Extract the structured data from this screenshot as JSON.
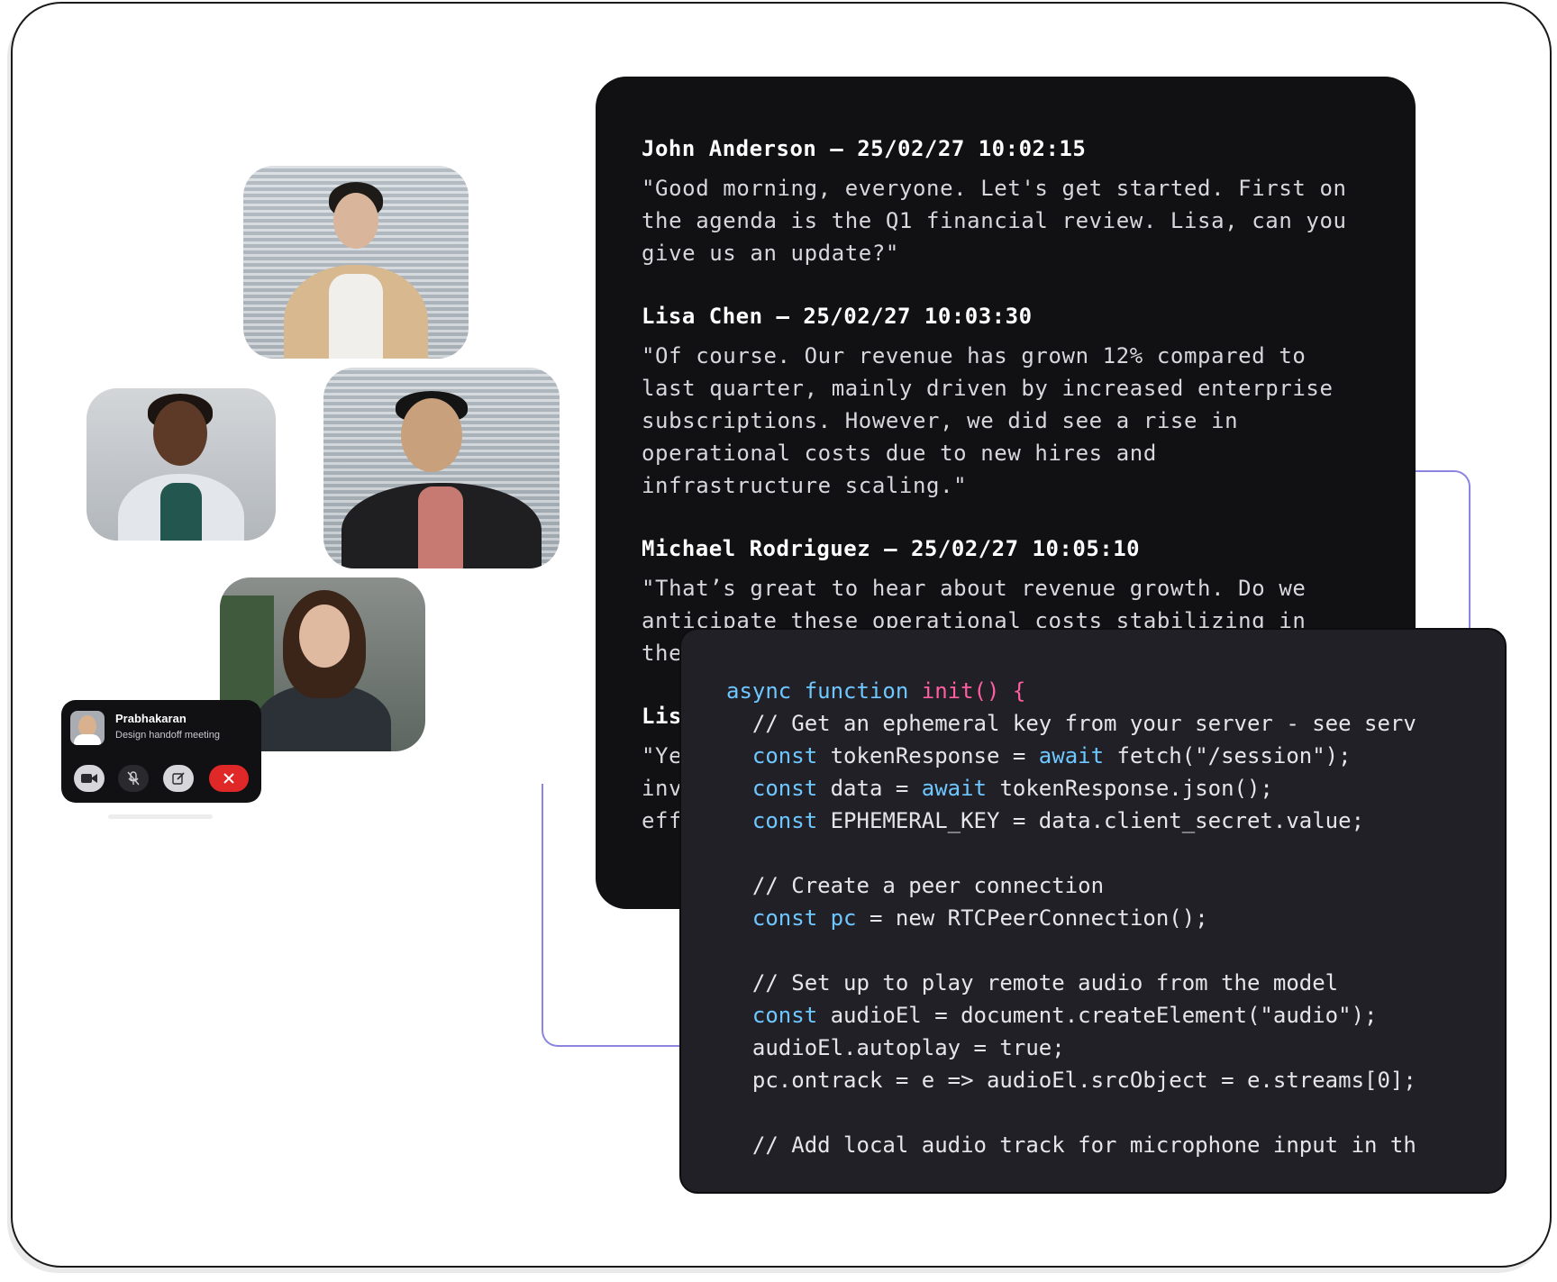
{
  "transcript": {
    "entries": [
      {
        "speaker": "John Anderson – 25/02/27 10:02:15",
        "quote": "\"Good morning, everyone. Let's get started. First on\nthe agenda is the Q1 financial review. Lisa, can you\ngive us an update?\""
      },
      {
        "speaker": "Lisa Chen – 25/02/27 10:03:30",
        "quote": "\"Of course. Our revenue has grown 12% compared to\nlast quarter, mainly driven by increased enterprise\nsubscriptions. However, we did see a rise in\noperational costs due to new hires and\ninfrastructure scaling.\""
      },
      {
        "speaker": "Michael Rodriguez – 25/02/27 10:05:10",
        "quote": "\"That’s great to hear about revenue growth. Do we\nanticipate these operational costs stabilizing in\nthe"
      },
      {
        "speaker": "Lis",
        "quote": "\"Ye\ninv\neff"
      }
    ]
  },
  "code": {
    "lines": [
      [
        {
          "t": "async function ",
          "c": "kw"
        },
        {
          "t": "init() {",
          "c": "fn"
        }
      ],
      [
        {
          "t": "  // Get an ephemeral key from your server - see serv"
        }
      ],
      [
        {
          "t": "  "
        },
        {
          "t": "const",
          "c": "kw"
        },
        {
          "t": " tokenResponse = "
        },
        {
          "t": "await",
          "c": "kw"
        },
        {
          "t": " fetch(\"/session\");"
        }
      ],
      [
        {
          "t": "  "
        },
        {
          "t": "const",
          "c": "kw"
        },
        {
          "t": " data = "
        },
        {
          "t": "await",
          "c": "kw"
        },
        {
          "t": " tokenResponse.json();"
        }
      ],
      [
        {
          "t": "  "
        },
        {
          "t": "const",
          "c": "kw"
        },
        {
          "t": " EPHEMERAL_KEY = data.client_secret.value;"
        }
      ],
      [
        {
          "t": ""
        }
      ],
      [
        {
          "t": "  // Create a peer connection"
        }
      ],
      [
        {
          "t": "  "
        },
        {
          "t": "const",
          "c": "kw"
        },
        {
          "t": " "
        },
        {
          "t": "pc",
          "c": "kw"
        },
        {
          "t": " = new RTCPeerConnection();"
        }
      ],
      [
        {
          "t": ""
        }
      ],
      [
        {
          "t": "  // Set up to play remote audio from the model"
        }
      ],
      [
        {
          "t": "  "
        },
        {
          "t": "const",
          "c": "kw"
        },
        {
          "t": " audioEl = document.createElement(\"audio\");"
        }
      ],
      [
        {
          "t": "  audioEl.autoplay = true;"
        }
      ],
      [
        {
          "t": "  pc.ontrack = e => audioEl.srcObject = e.streams[0];"
        }
      ],
      [
        {
          "t": ""
        }
      ],
      [
        {
          "t": "  // Add local audio track for microphone input in th"
        }
      ]
    ]
  },
  "call": {
    "name": "Prabhakaran",
    "subtitle": "Design handoff meeting",
    "buttons": [
      "camera-icon",
      "mic-off-icon",
      "edit-icon",
      "end-call-icon"
    ]
  },
  "colors": {
    "keyword": "#6ec7ff",
    "function": "#ff5fa2",
    "end_call": "#e02828",
    "connector": "#8b84e0"
  }
}
